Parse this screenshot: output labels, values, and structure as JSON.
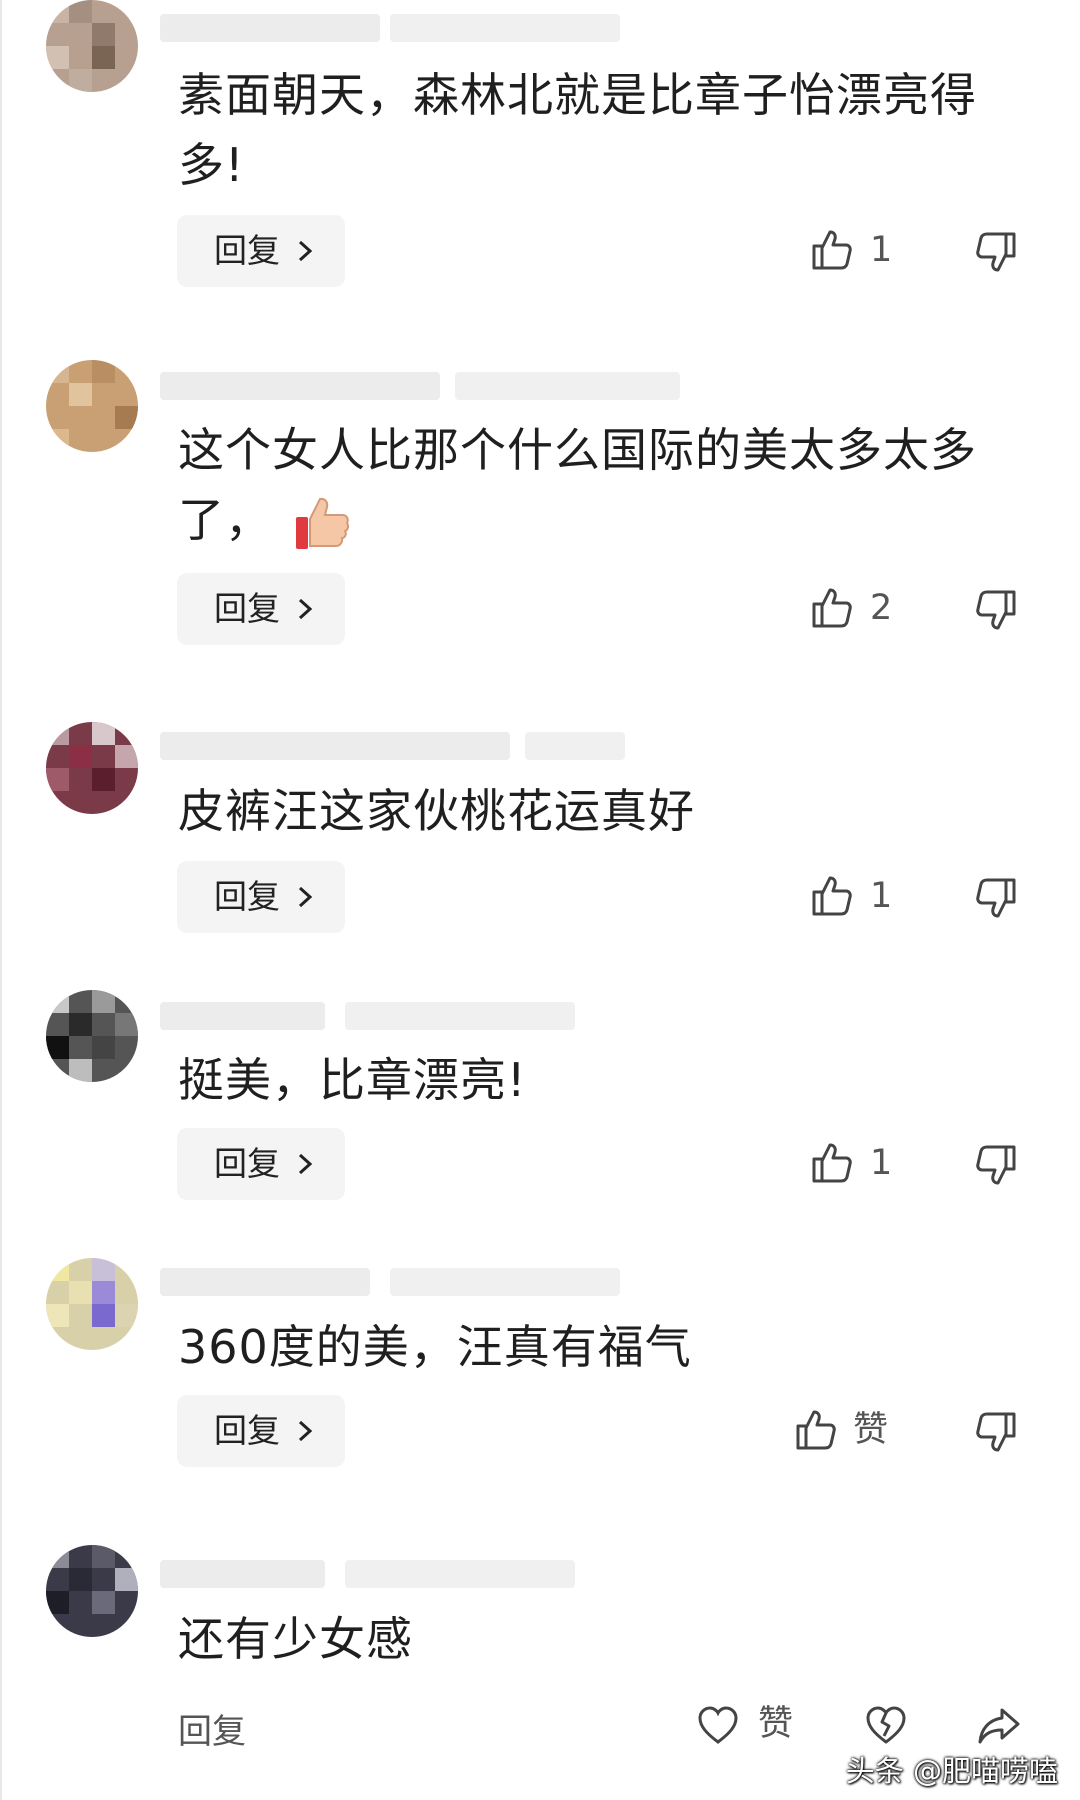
{
  "comments": [
    {
      "text": "素面朝天，森林北就是比章子怡漂亮得多!",
      "reply_label": "回复",
      "like_count": "1"
    },
    {
      "text": "这个女人比那个什么国际的美太多太多了，",
      "emoji_name": "thumbs-up-emoji",
      "reply_label": "回复",
      "like_count": "2"
    },
    {
      "text": "皮裤汪这家伙桃花运真好",
      "reply_label": "回复",
      "like_count": "1"
    },
    {
      "text": "挺美，比章漂亮!",
      "reply_label": "回复",
      "like_count": "1"
    },
    {
      "text": "360度的美，汪真有福气",
      "reply_label": "回复",
      "like_count": "赞"
    },
    {
      "text": "还有少女感",
      "reply_label": "回复",
      "like_label": "赞"
    }
  ],
  "watermark": "头条 @肥喵唠嗑",
  "icons": [
    "thumbs-up-icon",
    "thumbs-down-icon",
    "heart-icon",
    "broken-heart-icon",
    "share-icon",
    "chevron-right-icon"
  ],
  "colors": {
    "reply_bg": "#f4f4f4",
    "text": "#1f1f1f",
    "muted": "#555555"
  }
}
